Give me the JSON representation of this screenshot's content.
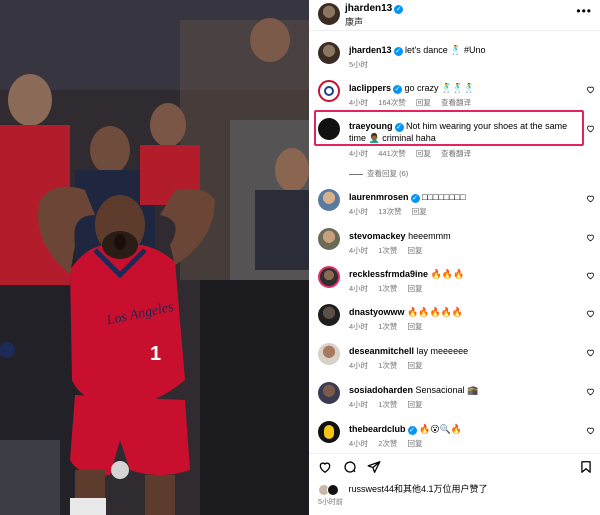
{
  "post": {
    "author": "jharden13",
    "verified": true,
    "subtitle": "康声",
    "more_icon": "more-horizontal-icon"
  },
  "caption": {
    "username": "jharden13",
    "text": "let's dance 🕺 #Uno",
    "time": "5小时"
  },
  "comments": [
    {
      "username": "laclippers",
      "verified": true,
      "text": "go crazy 🕺🕺🕺",
      "time": "4小时",
      "likes": "164次赞",
      "reply": "回复",
      "translate": "查看翻译"
    },
    {
      "username": "traeyoung",
      "verified": true,
      "text": "Not him wearing your shoes at the same time 🤦🏾‍♂️ criminal haha",
      "time": "4小时",
      "likes": "441次赞",
      "reply": "回复",
      "translate": "查看翻译",
      "view_replies": "查看回复 (6)"
    },
    {
      "username": "laurenmrosen",
      "verified": true,
      "text": "□□□□□□□□",
      "time": "4小时",
      "likes": "13次赞",
      "reply": "回复"
    },
    {
      "username": "stevomackey",
      "verified": false,
      "text": "heeemmm",
      "time": "4小时",
      "likes": "1次赞",
      "reply": "回复"
    },
    {
      "username": "recklessfrmda9ine",
      "verified": false,
      "text": "🔥🔥🔥",
      "time": "4小时",
      "likes": "1次赞",
      "reply": "回复"
    },
    {
      "username": "dnastyowww",
      "verified": false,
      "text": "🔥🔥🔥🔥🔥",
      "time": "4小时",
      "likes": "1次赞",
      "reply": "回复"
    },
    {
      "username": "deseanmitchell",
      "verified": false,
      "text": "lay meeeeee",
      "time": "4小时",
      "likes": "1次赞",
      "reply": "回复"
    },
    {
      "username": "sosiadoharden",
      "verified": false,
      "text": "Sensacional 🕋",
      "time": "4小时",
      "likes": "1次赞",
      "reply": "回复"
    },
    {
      "username": "thebeardclub",
      "verified": true,
      "text": "🔥😮🔍🔥",
      "time": "4小时",
      "likes": "2次赞",
      "reply": "回复"
    }
  ],
  "footer": {
    "likes_text": "russwest44和其他4.1万位用户赞了",
    "time": "5小时前"
  },
  "colors": {
    "highlight": "#e0245e",
    "verified": "#0095f6",
    "clippers_red": "#c8102e"
  },
  "photo": {
    "jersey_text": "Los Angeles",
    "jersey_number": "1"
  }
}
